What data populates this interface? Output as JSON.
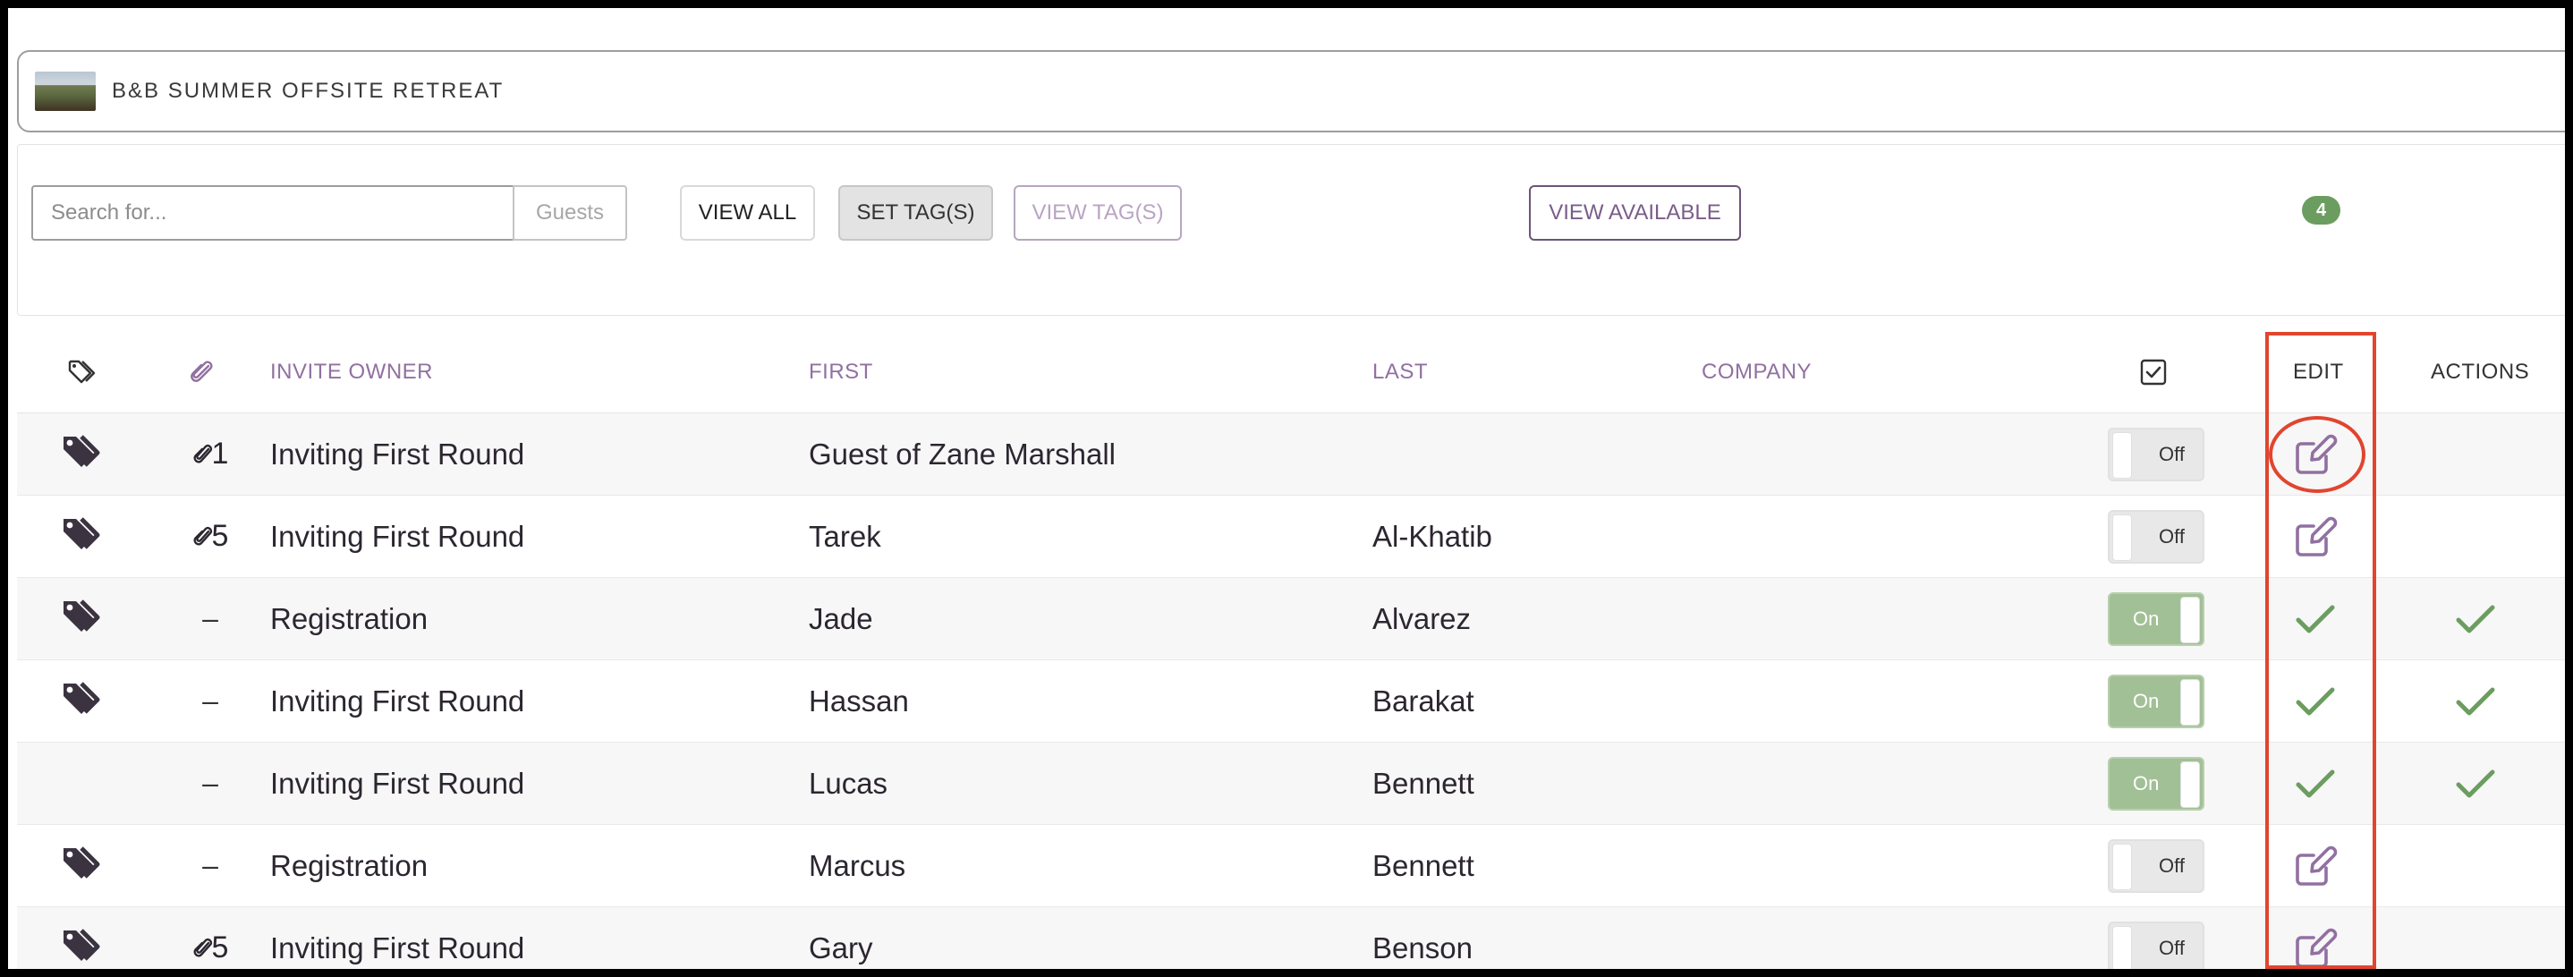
{
  "event": {
    "title": "B&B SUMMER OFFSITE RETREAT"
  },
  "toolbar": {
    "search_placeholder": "Search for...",
    "search_addon": "Guests",
    "view_all": "VIEW ALL",
    "set_tags": "SET TAG(S)",
    "view_tags": "VIEW TAG(S)",
    "view_available": "VIEW AVAILABLE",
    "count_badge": "4"
  },
  "table": {
    "headers": {
      "tag_icon": "tag-outline-icon",
      "clip_icon": "paperclip-icon",
      "invite_owner": "INVITE OWNER",
      "first": "FIRST",
      "last": "LAST",
      "company": "COMPANY",
      "checkbox_icon": "checkbox-icon",
      "edit": "EDIT",
      "actions": "ACTIONS"
    },
    "rows": [
      {
        "tagged": true,
        "attachments": "1",
        "owner": "Inviting First Round",
        "first": "Guest of Zane Marshall",
        "last": "",
        "company": "",
        "toggle": "Off",
        "edit": "edit-icon",
        "action": ""
      },
      {
        "tagged": true,
        "attachments": "5",
        "owner": "Inviting First Round",
        "first": "Tarek",
        "last": "Al-Khatib",
        "company": "",
        "toggle": "Off",
        "edit": "edit-icon",
        "action": ""
      },
      {
        "tagged": true,
        "attachments": "–",
        "owner": "Registration",
        "first": "Jade",
        "last": "Alvarez",
        "company": "",
        "toggle": "On",
        "edit": "check-icon",
        "action": "check-icon"
      },
      {
        "tagged": true,
        "attachments": "–",
        "owner": "Inviting First Round",
        "first": "Hassan",
        "last": "Barakat",
        "company": "",
        "toggle": "On",
        "edit": "check-icon",
        "action": "check-icon"
      },
      {
        "tagged": false,
        "attachments": "–",
        "owner": "Inviting First Round",
        "first": "Lucas",
        "last": "Bennett",
        "company": "",
        "toggle": "On",
        "edit": "check-icon",
        "action": "check-icon"
      },
      {
        "tagged": true,
        "attachments": "–",
        "owner": "Registration",
        "first": "Marcus",
        "last": "Bennett",
        "company": "",
        "toggle": "Off",
        "edit": "edit-icon",
        "action": ""
      },
      {
        "tagged": true,
        "attachments": "5",
        "owner": "Inviting First Round",
        "first": "Gary",
        "last": "Benson",
        "company": "",
        "toggle": "Off",
        "edit": "edit-icon",
        "action": ""
      }
    ]
  },
  "colors": {
    "accent_purple": "#9170a1",
    "check_green": "#6c9d60",
    "toggle_on": "#a2c096",
    "annotation_red": "#e1452f"
  }
}
